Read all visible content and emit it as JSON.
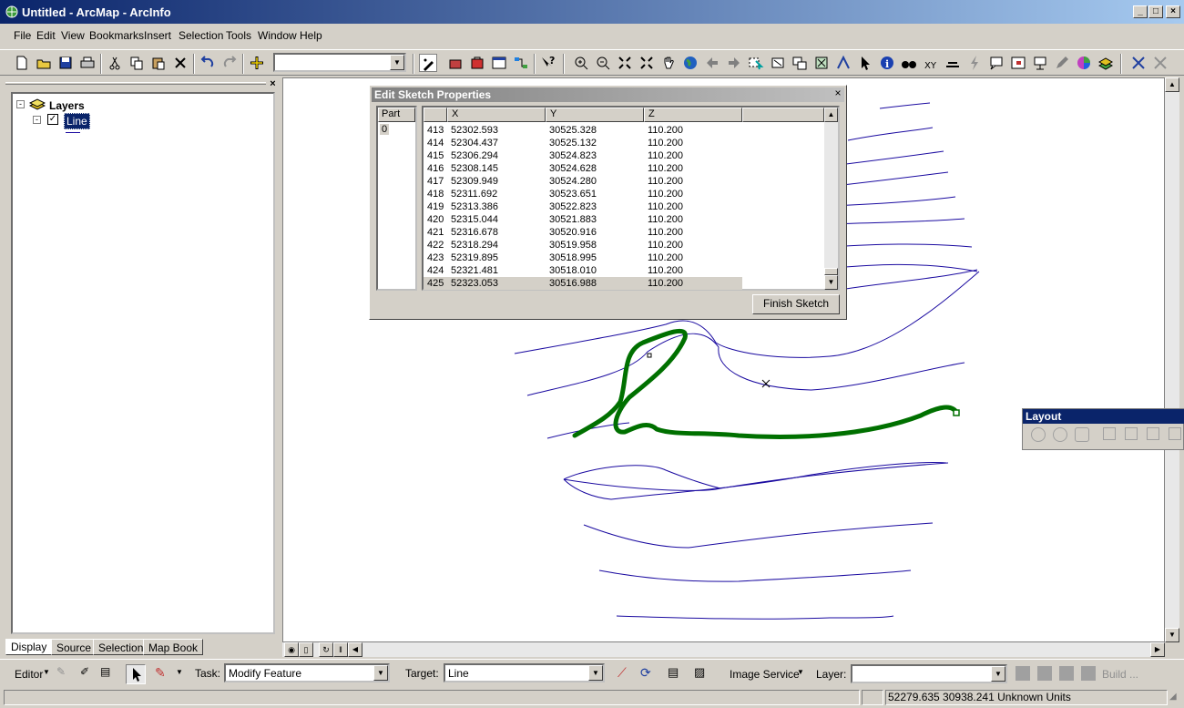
{
  "window": {
    "title": "Untitled - ArcMap - ArcInfo"
  },
  "menu": [
    "File",
    "Edit",
    "View",
    "Bookmarks",
    "Insert",
    "Selection",
    "Tools",
    "Window",
    "Help"
  ],
  "toc": {
    "root": "Layers",
    "layer": "Line",
    "tabs": [
      "Display",
      "Source",
      "Selection",
      "Map Book"
    ]
  },
  "dialog": {
    "title": "Edit Sketch Properties",
    "part_header": "Part",
    "part_value": "0",
    "columns": [
      "X",
      "Y",
      "Z"
    ],
    "rows": [
      [
        "413",
        "52302.593",
        "30525.328",
        "110.200"
      ],
      [
        "414",
        "52304.437",
        "30525.132",
        "110.200"
      ],
      [
        "415",
        "52306.294",
        "30524.823",
        "110.200"
      ],
      [
        "416",
        "52308.145",
        "30524.628",
        "110.200"
      ],
      [
        "417",
        "52309.949",
        "30524.280",
        "110.200"
      ],
      [
        "418",
        "52311.692",
        "30523.651",
        "110.200"
      ],
      [
        "419",
        "52313.386",
        "30522.823",
        "110.200"
      ],
      [
        "420",
        "52315.044",
        "30521.883",
        "110.200"
      ],
      [
        "421",
        "52316.678",
        "30520.916",
        "110.200"
      ],
      [
        "422",
        "52318.294",
        "30519.958",
        "110.200"
      ],
      [
        "423",
        "52319.895",
        "30518.995",
        "110.200"
      ],
      [
        "424",
        "52321.481",
        "30518.010",
        "110.200"
      ],
      [
        "425",
        "52323.053",
        "30516.988",
        "110.200"
      ]
    ],
    "finish_label": "Finish Sketch"
  },
  "layout_toolbar": {
    "title": "Layout"
  },
  "editor_bar": {
    "editor_label": "Editor",
    "task_label": "Task:",
    "task_value": "Modify Feature",
    "target_label": "Target:",
    "target_value": "Line",
    "image_service_label": "Image Service",
    "layer_label": "Layer:",
    "build_label": "Build ..."
  },
  "status": {
    "coords": "52279.635  30938.241 Unknown Units"
  },
  "colors": {
    "sketch": "#007000",
    "contour": "#1a0aa0"
  }
}
